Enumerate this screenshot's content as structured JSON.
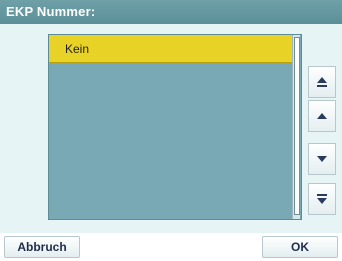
{
  "window": {
    "title": "EKP Nummer:"
  },
  "list": {
    "items": [
      {
        "label": "Kein",
        "selected": true
      }
    ]
  },
  "nav": {
    "first": "double-up-icon",
    "up": "chevron-up-icon",
    "down": "chevron-down-icon",
    "last": "double-down-icon"
  },
  "footer": {
    "cancel_label": "Abbruch",
    "ok_label": "OK"
  },
  "colors": {
    "title_bar": "#5f949d",
    "list_bg": "#79a9b4",
    "selected_row": "#e9d226",
    "button_text": "#1f2d4b",
    "screen_bg": "#e6f4f5"
  }
}
